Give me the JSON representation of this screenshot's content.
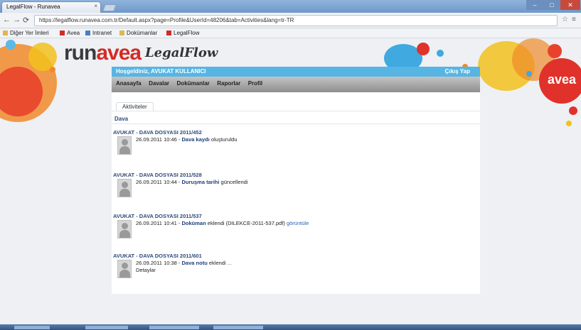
{
  "browser": {
    "tab_title": "LegalFlow - Runavea",
    "tab_close": "×",
    "new_tab": "",
    "window_controls": {
      "minimize": "–",
      "maximize": "□",
      "close": "✕"
    },
    "nav": {
      "back": "←",
      "forward": "→",
      "reload": "⟳"
    },
    "url": "https://legalflow.runavea.com.tr/Default.aspx?page=Profile&UserId=48206&tab=Activities&lang=tr-TR",
    "star_icon": "☆",
    "wrench_icon": "🔧",
    "bookmarks": [
      {
        "label": "Diğer Yer İmleri",
        "color": "#e0b84a"
      },
      {
        "label": "Avea",
        "color": "#d42b26"
      },
      {
        "label": "Intranet",
        "color": "#4a7fc1"
      },
      {
        "label": "Dokümanlar",
        "color": "#e0b84a"
      },
      {
        "label": "LegalFlow",
        "color": "#d42b26"
      }
    ]
  },
  "header": {
    "logo_run": "run",
    "logo_avea": "avea",
    "app_name": "LegalFlow",
    "badge_text": "avea"
  },
  "userbar": {
    "user_label": "Hoşgeldiniz, AVUKAT KULLANICI",
    "logout_label": "Çıkış Yap"
  },
  "menu": [
    "Anasayfa",
    "Davalar",
    "Dokümanlar",
    "Raporlar",
    "Profil"
  ],
  "subtab": "Aktiviteler",
  "section_title": "Dava",
  "entries": [
    {
      "head": "AVUKAT - DAVA DOSYASI 2011/452",
      "date": "26.09.2011 10:46",
      "action": "Dava kaydı",
      "detail": "oluşturuldu",
      "link": "",
      "line2": ""
    },
    {
      "head": "AVUKAT - DAVA DOSYASI 2011/528",
      "date": "26.09.2011 10:44",
      "action": "Duruşma tarihi",
      "detail": "güncellendi",
      "link": "",
      "line2": ""
    },
    {
      "head": "AVUKAT - DAVA DOSYASI 2011/537",
      "date": "26.09.2011 10:41",
      "action": "Doküman",
      "detail": "eklendi (DILEKCE-2011-537.pdf)",
      "link": "görüntüle",
      "line2": ""
    },
    {
      "head": "AVUKAT - DAVA DOSYASI 2011/601",
      "date": "26.09.2011 10:38",
      "action": "Dava notu",
      "detail": "eklendi",
      "link": "...",
      "line2": "Detaylar"
    }
  ],
  "colors": {
    "accent_blue": "#57b5e3",
    "brand_red": "#d42b26",
    "menu_gray": "#a9a9a9"
  }
}
